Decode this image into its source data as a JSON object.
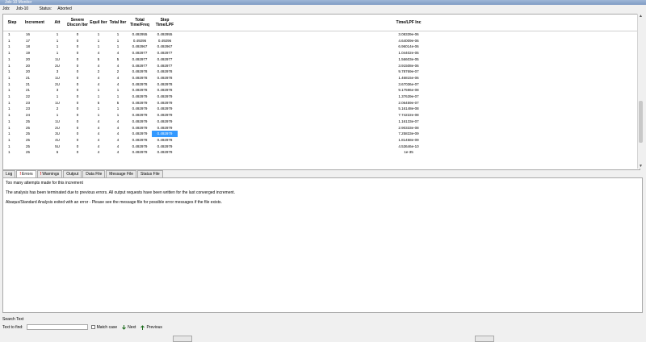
{
  "window": {
    "title": "Job-10 Monitor"
  },
  "job": {
    "job_label": "Job:",
    "job_name": "Job-10",
    "status_label": "Status:",
    "status_value": "Aborted"
  },
  "table": {
    "headers": [
      "Step",
      "Increment",
      "Att",
      "Severe Discon Iter",
      "Equil Iter",
      "Total Iter",
      "Total Time/Freq",
      "Step Time/LPF",
      "Time/LPF Inc"
    ],
    "rows": [
      [
        "1",
        "16",
        "1",
        "0",
        "1",
        "1",
        "0.492955",
        "0.492955",
        "3.08339e-06"
      ],
      [
        "1",
        "17",
        "1",
        "0",
        "1",
        "1",
        "0.49296",
        "0.49296",
        "4.64009e-06"
      ],
      [
        "1",
        "18",
        "1",
        "0",
        "1",
        "1",
        "0.492967",
        "0.492967",
        "6.96014e-06"
      ],
      [
        "1",
        "19",
        "1",
        "0",
        "4",
        "4",
        "0.492977",
        "0.492977",
        "1.04402e-05"
      ],
      [
        "1",
        "20",
        "1U",
        "0",
        "5",
        "5",
        "0.492977",
        "0.492977",
        "1.56603e-05"
      ],
      [
        "1",
        "20",
        "2U",
        "0",
        "4",
        "4",
        "0.492977",
        "0.492977",
        "3.91508e-06"
      ],
      [
        "1",
        "20",
        "3",
        "0",
        "2",
        "2",
        "0.492978",
        "0.492978",
        "9.78769e-07"
      ],
      [
        "1",
        "21",
        "1U",
        "0",
        "4",
        "4",
        "0.492978",
        "0.492978",
        "1.46815e-06"
      ],
      [
        "1",
        "21",
        "2U",
        "0",
        "4",
        "4",
        "0.492978",
        "0.492978",
        "3.67036e-07"
      ],
      [
        "1",
        "21",
        "3",
        "0",
        "1",
        "1",
        "0.492978",
        "0.492978",
        "9.17596e-08"
      ],
      [
        "1",
        "22",
        "1",
        "0",
        "1",
        "1",
        "0.492979",
        "0.492979",
        "1.37639e-07"
      ],
      [
        "1",
        "23",
        "1U",
        "0",
        "5",
        "5",
        "0.492979",
        "0.492979",
        "2.06459e-07"
      ],
      [
        "1",
        "23",
        "2",
        "0",
        "1",
        "1",
        "0.492979",
        "0.492979",
        "5.16148e-08"
      ],
      [
        "1",
        "24",
        "1",
        "0",
        "1",
        "1",
        "0.492979",
        "0.492979",
        "7.74222e-08"
      ],
      [
        "1",
        "25",
        "1U",
        "0",
        "4",
        "4",
        "0.492979",
        "0.492979",
        "1.16133e-07"
      ],
      [
        "1",
        "25",
        "2U",
        "0",
        "4",
        "4",
        "0.492979",
        "0.492979",
        "2.90333e-08"
      ],
      [
        "1",
        "25",
        "3U",
        "0",
        "4",
        "4",
        "0.492979",
        "0.492979",
        "7.25833e-09"
      ],
      [
        "1",
        "25",
        "4U",
        "0",
        "4",
        "4",
        "0.492978",
        "0.492978",
        "1.81458e-09"
      ],
      [
        "1",
        "25",
        "5U",
        "0",
        "4",
        "4",
        "0.492979",
        "0.492979",
        "4.53646e-10"
      ],
      [
        "1",
        "25",
        "6",
        "0",
        "4",
        "4",
        "0.492979",
        "0.492979",
        "1e-35"
      ]
    ]
  },
  "tabs": [
    {
      "label": "Log",
      "warn": ""
    },
    {
      "label": "Errors",
      "warn": "!"
    },
    {
      "label": "Warnings",
      "warn": "!"
    },
    {
      "label": "Output",
      "warn": ""
    },
    {
      "label": "Data File",
      "warn": ""
    },
    {
      "label": "Message File",
      "warn": ""
    },
    {
      "label": "Status File",
      "warn": ""
    }
  ],
  "messages": [
    "Too many attempts made for this increment",
    "The analysis has been terminated due to previous errors. All output requests have been written for the last converged increment.",
    "Abaqus/Standard Analysis exited with an error - Please see the  message file for possible error messages if the file exists."
  ],
  "search": {
    "section_label": "Search Text",
    "find_label": "Text to find:",
    "find_value": "",
    "match_case_label": "Match case",
    "next_label": "Next",
    "previous_label": "Previous"
  }
}
